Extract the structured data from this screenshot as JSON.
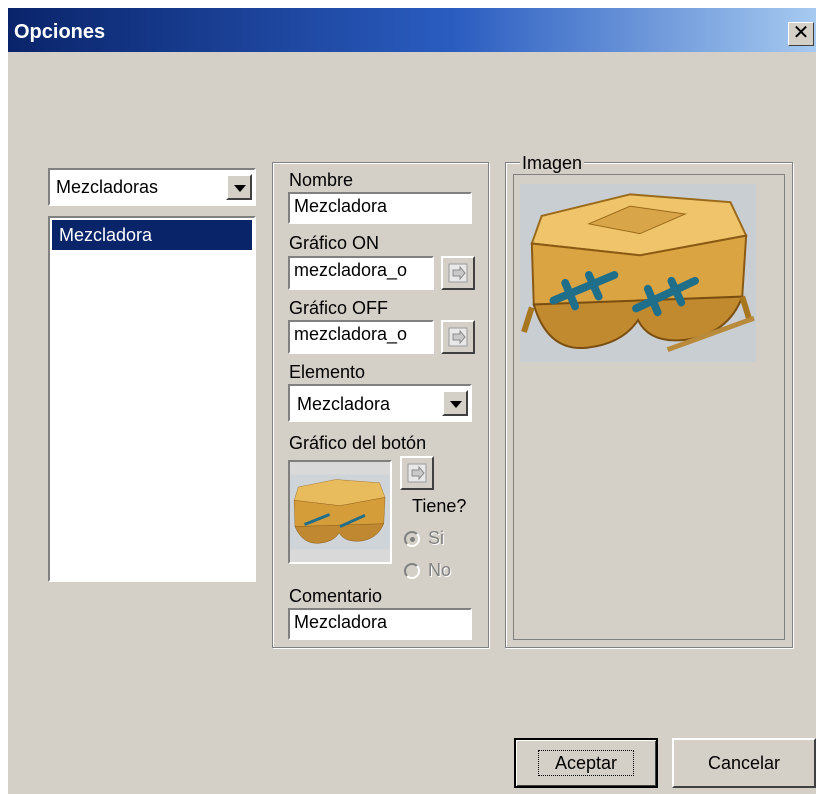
{
  "window": {
    "title": "Opciones",
    "close_glyph": "✕"
  },
  "category_combo": {
    "value": "Mezcladoras"
  },
  "list": {
    "items": [
      "Mezcladora"
    ],
    "selected_index": 0
  },
  "form": {
    "nombre_label": "Nombre",
    "nombre_value": "Mezcladora",
    "grafico_on_label": "Gráfico ON",
    "grafico_on_value": "mezcladora_o",
    "grafico_off_label": "Gráfico OFF",
    "grafico_off_value": "mezcladora_o",
    "elemento_label": "Elemento",
    "elemento_value": "Mezcladora",
    "boton_label": "Gráfico del botón",
    "tiene_label": "Tiene?",
    "radio_si_label": "Si",
    "radio_no_label": "No",
    "comentario_label": "Comentario",
    "comentario_value": "Mezcladora"
  },
  "image_group": {
    "label": "Imagen"
  },
  "buttons": {
    "accept": "Aceptar",
    "cancel": "Cancelar"
  },
  "colors": {
    "dialog_bg": "#d4d0c8",
    "title_start": "#0a246a",
    "title_end": "#a6caf0",
    "selection": "#0a246a",
    "machine_gold": "#d9a441",
    "shaft_teal": "#1f6f8b"
  },
  "icons": [
    "close-icon",
    "dropdown-arrow-icon",
    "browse-folder-icon",
    "mixer-machine-image",
    "radio-button-icon"
  ]
}
